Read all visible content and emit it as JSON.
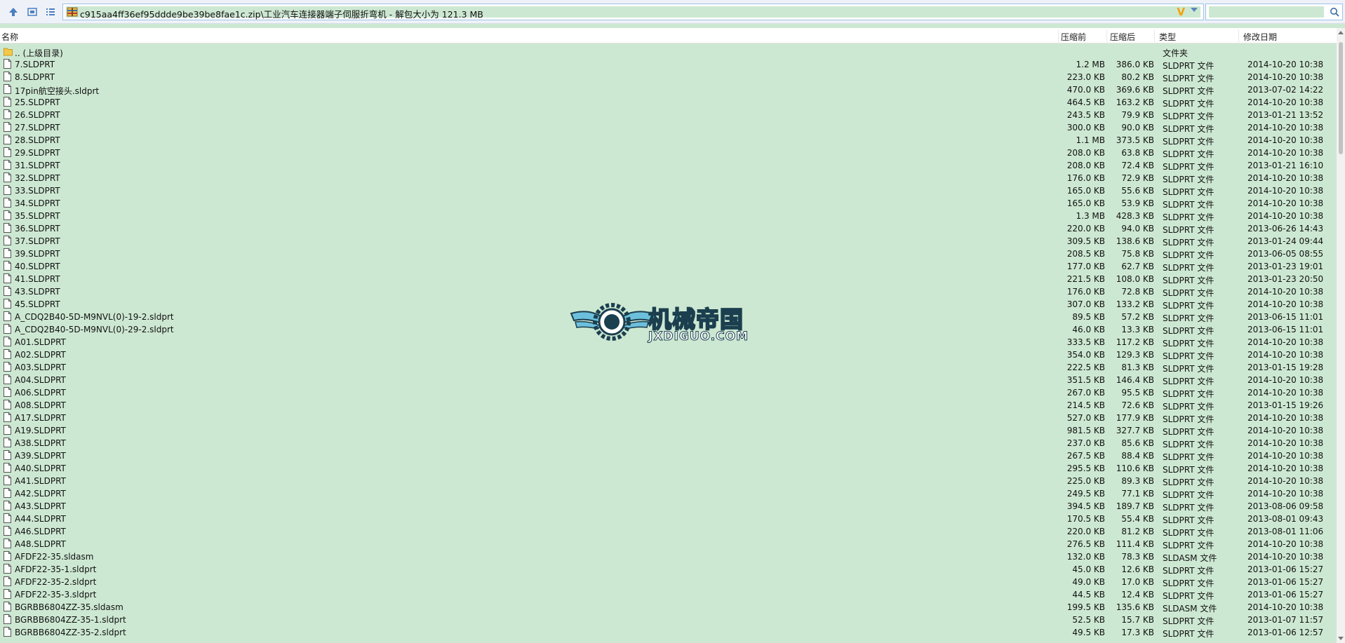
{
  "address": {
    "path": "c915aa4ff36ef95ddde9be39be8fae1c.zip\\工业汽车连接器端子伺服折弯机 - 解包大小为 121.3 MB",
    "search_placeholder": ""
  },
  "columns": {
    "name": "名称",
    "compressed": "压缩前",
    "original": "压缩后",
    "type": "类型",
    "date": "修改日期"
  },
  "rows": [
    {
      "name": ".. (上级目录)",
      "comp": "",
      "orig": "",
      "type": "文件夹",
      "date": "",
      "folder": true
    },
    {
      "name": "7.SLDPRT",
      "comp": "1.2 MB",
      "orig": "386.0 KB",
      "type": "SLDPRT 文件",
      "date": "2014-10-20 10:38"
    },
    {
      "name": "8.SLDPRT",
      "comp": "223.0 KB",
      "orig": "80.2 KB",
      "type": "SLDPRT 文件",
      "date": "2014-10-20 10:38"
    },
    {
      "name": "17pin航空接头.sldprt",
      "comp": "470.0 KB",
      "orig": "369.6 KB",
      "type": "SLDPRT 文件",
      "date": "2013-07-02 14:22"
    },
    {
      "name": "25.SLDPRT",
      "comp": "464.5 KB",
      "orig": "163.2 KB",
      "type": "SLDPRT 文件",
      "date": "2014-10-20 10:38"
    },
    {
      "name": "26.SLDPRT",
      "comp": "243.5 KB",
      "orig": "79.9 KB",
      "type": "SLDPRT 文件",
      "date": "2013-01-21 13:52"
    },
    {
      "name": "27.SLDPRT",
      "comp": "300.0 KB",
      "orig": "90.0 KB",
      "type": "SLDPRT 文件",
      "date": "2014-10-20 10:38"
    },
    {
      "name": "28.SLDPRT",
      "comp": "1.1 MB",
      "orig": "373.5 KB",
      "type": "SLDPRT 文件",
      "date": "2014-10-20 10:38"
    },
    {
      "name": "29.SLDPRT",
      "comp": "208.0 KB",
      "orig": "63.8 KB",
      "type": "SLDPRT 文件",
      "date": "2014-10-20 10:38"
    },
    {
      "name": "31.SLDPRT",
      "comp": "208.0 KB",
      "orig": "72.4 KB",
      "type": "SLDPRT 文件",
      "date": "2013-01-21 16:10"
    },
    {
      "name": "32.SLDPRT",
      "comp": "176.0 KB",
      "orig": "72.9 KB",
      "type": "SLDPRT 文件",
      "date": "2014-10-20 10:38"
    },
    {
      "name": "33.SLDPRT",
      "comp": "165.0 KB",
      "orig": "55.6 KB",
      "type": "SLDPRT 文件",
      "date": "2014-10-20 10:38"
    },
    {
      "name": "34.SLDPRT",
      "comp": "165.0 KB",
      "orig": "53.9 KB",
      "type": "SLDPRT 文件",
      "date": "2014-10-20 10:38"
    },
    {
      "name": "35.SLDPRT",
      "comp": "1.3 MB",
      "orig": "428.3 KB",
      "type": "SLDPRT 文件",
      "date": "2014-10-20 10:38"
    },
    {
      "name": "36.SLDPRT",
      "comp": "220.0 KB",
      "orig": "94.0 KB",
      "type": "SLDPRT 文件",
      "date": "2013-06-26 14:43"
    },
    {
      "name": "37.SLDPRT",
      "comp": "309.5 KB",
      "orig": "138.6 KB",
      "type": "SLDPRT 文件",
      "date": "2013-01-24 09:44"
    },
    {
      "name": "39.SLDPRT",
      "comp": "208.5 KB",
      "orig": "75.8 KB",
      "type": "SLDPRT 文件",
      "date": "2013-06-05 08:55"
    },
    {
      "name": "40.SLDPRT",
      "comp": "177.0 KB",
      "orig": "62.7 KB",
      "type": "SLDPRT 文件",
      "date": "2013-01-23 19:01"
    },
    {
      "name": "41.SLDPRT",
      "comp": "221.5 KB",
      "orig": "108.0 KB",
      "type": "SLDPRT 文件",
      "date": "2013-01-23 20:50"
    },
    {
      "name": "43.SLDPRT",
      "comp": "176.0 KB",
      "orig": "72.8 KB",
      "type": "SLDPRT 文件",
      "date": "2014-10-20 10:38"
    },
    {
      "name": "45.SLDPRT",
      "comp": "307.0 KB",
      "orig": "133.2 KB",
      "type": "SLDPRT 文件",
      "date": "2014-10-20 10:38"
    },
    {
      "name": "A_CDQ2B40-5D-M9NVL(0)-19-2.sldprt",
      "comp": "89.5 KB",
      "orig": "57.2 KB",
      "type": "SLDPRT 文件",
      "date": "2013-06-15 11:01"
    },
    {
      "name": "A_CDQ2B40-5D-M9NVL(0)-29-2.sldprt",
      "comp": "46.0 KB",
      "orig": "13.3 KB",
      "type": "SLDPRT 文件",
      "date": "2013-06-15 11:01"
    },
    {
      "name": "A01.SLDPRT",
      "comp": "333.5 KB",
      "orig": "117.2 KB",
      "type": "SLDPRT 文件",
      "date": "2014-10-20 10:38"
    },
    {
      "name": "A02.SLDPRT",
      "comp": "354.0 KB",
      "orig": "129.3 KB",
      "type": "SLDPRT 文件",
      "date": "2014-10-20 10:38"
    },
    {
      "name": "A03.SLDPRT",
      "comp": "222.5 KB",
      "orig": "81.3 KB",
      "type": "SLDPRT 文件",
      "date": "2013-01-15 19:28"
    },
    {
      "name": "A04.SLDPRT",
      "comp": "351.5 KB",
      "orig": "146.4 KB",
      "type": "SLDPRT 文件",
      "date": "2014-10-20 10:38"
    },
    {
      "name": "A06.SLDPRT",
      "comp": "267.0 KB",
      "orig": "95.5 KB",
      "type": "SLDPRT 文件",
      "date": "2014-10-20 10:38"
    },
    {
      "name": "A08.SLDPRT",
      "comp": "214.5 KB",
      "orig": "72.6 KB",
      "type": "SLDPRT 文件",
      "date": "2013-01-15 19:26"
    },
    {
      "name": "A17.SLDPRT",
      "comp": "527.0 KB",
      "orig": "177.9 KB",
      "type": "SLDPRT 文件",
      "date": "2014-10-20 10:38"
    },
    {
      "name": "A19.SLDPRT",
      "comp": "981.5 KB",
      "orig": "327.7 KB",
      "type": "SLDPRT 文件",
      "date": "2014-10-20 10:38"
    },
    {
      "name": "A38.SLDPRT",
      "comp": "237.0 KB",
      "orig": "85.6 KB",
      "type": "SLDPRT 文件",
      "date": "2014-10-20 10:38"
    },
    {
      "name": "A39.SLDPRT",
      "comp": "267.5 KB",
      "orig": "88.4 KB",
      "type": "SLDPRT 文件",
      "date": "2014-10-20 10:38"
    },
    {
      "name": "A40.SLDPRT",
      "comp": "295.5 KB",
      "orig": "110.6 KB",
      "type": "SLDPRT 文件",
      "date": "2014-10-20 10:38"
    },
    {
      "name": "A41.SLDPRT",
      "comp": "225.0 KB",
      "orig": "89.3 KB",
      "type": "SLDPRT 文件",
      "date": "2014-10-20 10:38"
    },
    {
      "name": "A42.SLDPRT",
      "comp": "249.5 KB",
      "orig": "77.1 KB",
      "type": "SLDPRT 文件",
      "date": "2014-10-20 10:38"
    },
    {
      "name": "A43.SLDPRT",
      "comp": "394.5 KB",
      "orig": "189.7 KB",
      "type": "SLDPRT 文件",
      "date": "2013-08-06 09:58"
    },
    {
      "name": "A44.SLDPRT",
      "comp": "170.5 KB",
      "orig": "55.4 KB",
      "type": "SLDPRT 文件",
      "date": "2013-08-01 09:43"
    },
    {
      "name": "A46.SLDPRT",
      "comp": "220.0 KB",
      "orig": "81.2 KB",
      "type": "SLDPRT 文件",
      "date": "2013-08-01 11:06"
    },
    {
      "name": "A48.SLDPRT",
      "comp": "276.5 KB",
      "orig": "111.4 KB",
      "type": "SLDPRT 文件",
      "date": "2014-10-20 10:38"
    },
    {
      "name": "AFDF22-35.sldasm",
      "comp": "132.0 KB",
      "orig": "78.3 KB",
      "type": "SLDASM 文件",
      "date": "2014-10-20 10:38"
    },
    {
      "name": "AFDF22-35-1.sldprt",
      "comp": "45.0 KB",
      "orig": "12.6 KB",
      "type": "SLDPRT 文件",
      "date": "2013-01-06 15:27"
    },
    {
      "name": "AFDF22-35-2.sldprt",
      "comp": "49.0 KB",
      "orig": "17.0 KB",
      "type": "SLDPRT 文件",
      "date": "2013-01-06 15:27"
    },
    {
      "name": "AFDF22-35-3.sldprt",
      "comp": "44.5 KB",
      "orig": "12.4 KB",
      "type": "SLDPRT 文件",
      "date": "2013-01-06 15:27"
    },
    {
      "name": "BGRBB6804ZZ-35.sldasm",
      "comp": "199.5 KB",
      "orig": "135.6 KB",
      "type": "SLDASM 文件",
      "date": "2014-10-20 10:38"
    },
    {
      "name": "BGRBB6804ZZ-35-1.sldprt",
      "comp": "52.5 KB",
      "orig": "15.7 KB",
      "type": "SLDPRT 文件",
      "date": "2013-01-07 11:57"
    },
    {
      "name": "BGRBB6804ZZ-35-2.sldprt",
      "comp": "49.5 KB",
      "orig": "17.3 KB",
      "type": "SLDPRT 文件",
      "date": "2013-01-06 12:57"
    }
  ],
  "watermark": {
    "title": "机械帝国",
    "url": "JXDIGUO.COM"
  },
  "colors": {
    "list_background": "#cde8d2",
    "toolbar_background": "#eef2f8",
    "accent": "#3a6ea5"
  }
}
